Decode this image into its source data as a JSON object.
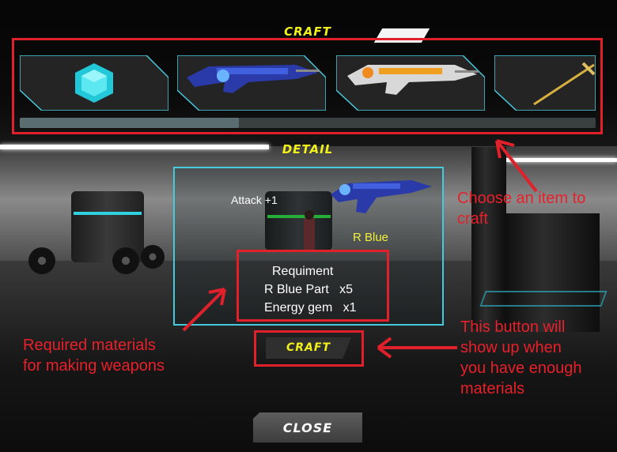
{
  "craft_panel": {
    "title": "CRAFT",
    "items": [
      {
        "name": "energy-gem",
        "icon": "cyan-gem-icon"
      },
      {
        "name": "r-blue-rifle",
        "icon": "blue-rifle-icon"
      },
      {
        "name": "orange-rifle",
        "icon": "orange-rifle-icon"
      },
      {
        "name": "golden-sword",
        "icon": "sword-icon"
      }
    ],
    "scroll_progress": 0.38
  },
  "detail_panel": {
    "title": "DETAIL",
    "attack": "Attack +1",
    "weapon_name": "R Blue",
    "requirements": {
      "heading": "Requiment",
      "lines": [
        "R Blue Part   x5",
        "Energy gem   x1"
      ]
    }
  },
  "buttons": {
    "craft_label": "CRAFT",
    "close_label": "CLOSE"
  },
  "annotations": {
    "choose_item": [
      "Choose an item to",
      "craft"
    ],
    "button_note": [
      "This button will",
      "show up when",
      "you have enough",
      "materials"
    ],
    "materials_note": [
      "Required materials",
      "for making weapons"
    ]
  },
  "colors": {
    "annotation_red": "#e0202a",
    "accent_cyan": "#45c9dc",
    "title_yellow": "#f2f21a"
  }
}
